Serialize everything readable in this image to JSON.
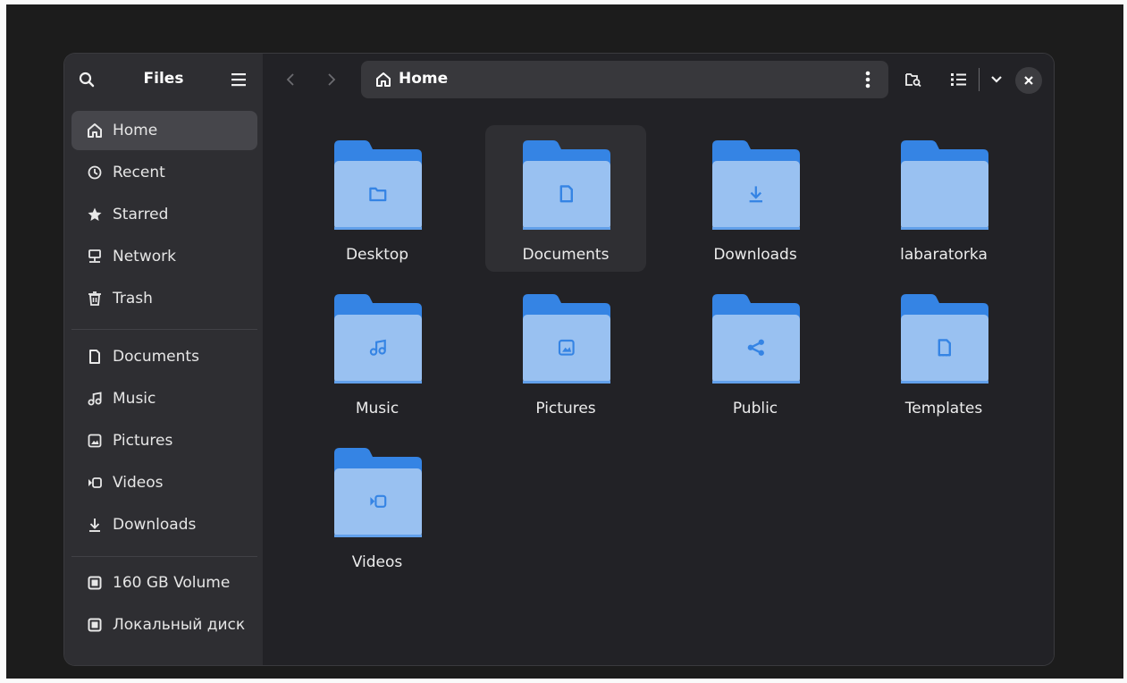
{
  "app": {
    "title": "Files"
  },
  "colors": {
    "window_bg": "#222226",
    "sidebar_bg": "#2e2e32",
    "folder_back": "#3584e4",
    "folder_front": "#99c1f1",
    "folder_glyph": "#3584e4"
  },
  "sidebar": {
    "places": [
      {
        "label": "Home",
        "icon": "home-icon",
        "active": true
      },
      {
        "label": "Recent",
        "icon": "clock-icon"
      },
      {
        "label": "Starred",
        "icon": "star-icon"
      },
      {
        "label": "Network",
        "icon": "network-icon"
      },
      {
        "label": "Trash",
        "icon": "trash-icon"
      }
    ],
    "bookmarks": [
      {
        "label": "Documents",
        "icon": "document-icon"
      },
      {
        "label": "Music",
        "icon": "music-icon"
      },
      {
        "label": "Pictures",
        "icon": "picture-icon"
      },
      {
        "label": "Videos",
        "icon": "video-icon"
      },
      {
        "label": "Downloads",
        "icon": "download-icon"
      }
    ],
    "devices": [
      {
        "label": "160 GB Volume",
        "icon": "drive-icon"
      },
      {
        "label": "Локальный диск",
        "icon": "drive-icon"
      }
    ]
  },
  "pathbar": {
    "location": "Home"
  },
  "folders": [
    {
      "label": "Desktop",
      "icon": "folder-glyph-icon",
      "selected": false
    },
    {
      "label": "Documents",
      "icon": "document-icon",
      "selected": true
    },
    {
      "label": "Downloads",
      "icon": "download-icon",
      "selected": false
    },
    {
      "label": "labaratorka",
      "icon": "",
      "selected": false
    },
    {
      "label": "Music",
      "icon": "music-icon",
      "selected": false
    },
    {
      "label": "Pictures",
      "icon": "picture-icon",
      "selected": false
    },
    {
      "label": "Public",
      "icon": "share-icon",
      "selected": false
    },
    {
      "label": "Templates",
      "icon": "template-icon",
      "selected": false
    },
    {
      "label": "Videos",
      "icon": "video-icon",
      "selected": false
    }
  ]
}
